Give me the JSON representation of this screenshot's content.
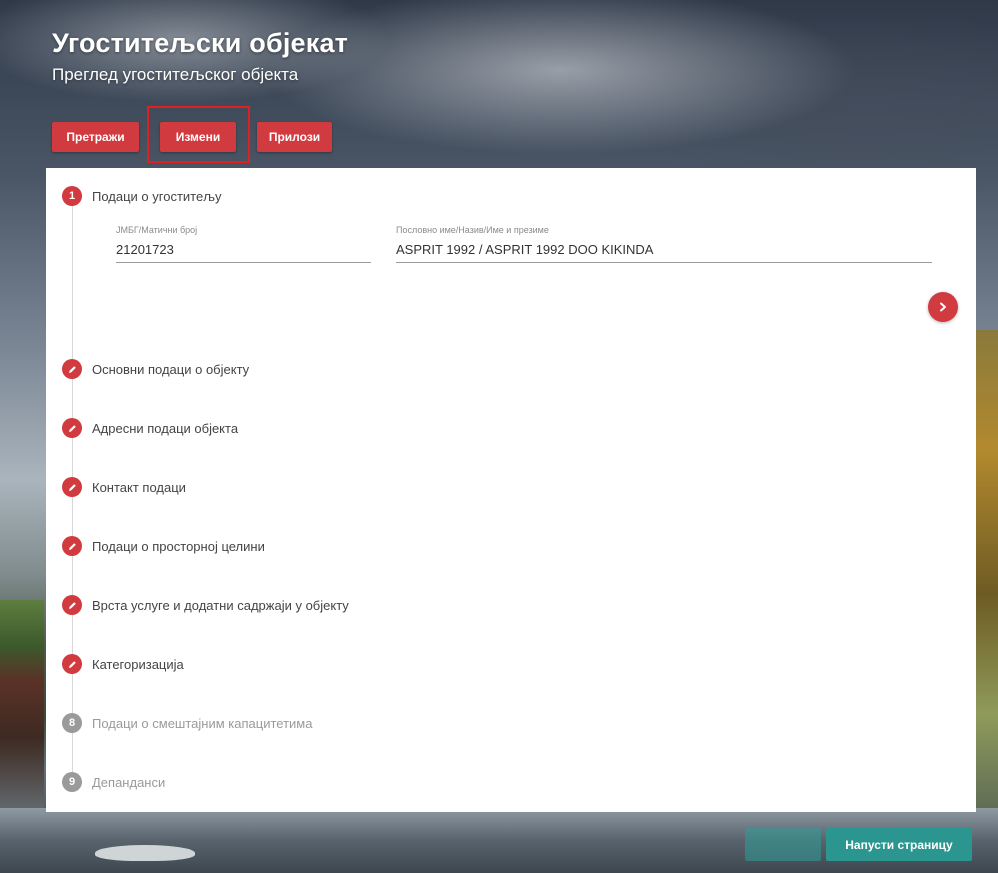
{
  "header": {
    "title": "Угоститељски објекат",
    "subtitle": "Преглед угоститељског објекта"
  },
  "toolbar": {
    "search_label": "Претражи",
    "edit_label": "Измени",
    "attachments_label": "Прилози"
  },
  "steps": [
    {
      "marker": "1",
      "label": "Подаци о угоститељу",
      "state": "active"
    },
    {
      "marker": "edit-icon",
      "label": "Основни подаци о објекту",
      "state": "editable"
    },
    {
      "marker": "edit-icon",
      "label": "Адресни подаци објекта",
      "state": "editable"
    },
    {
      "marker": "edit-icon",
      "label": "Контакт подаци",
      "state": "editable"
    },
    {
      "marker": "edit-icon",
      "label": "Подаци о просторној целини",
      "state": "editable"
    },
    {
      "marker": "edit-icon",
      "label": "Врста услуге и додатни садржаји у објекту",
      "state": "editable"
    },
    {
      "marker": "edit-icon",
      "label": "Категоризација",
      "state": "editable"
    },
    {
      "marker": "8",
      "label": "Подаци о смештајним капацитетима",
      "state": "disabled"
    },
    {
      "marker": "9",
      "label": "Депанданси",
      "state": "disabled"
    }
  ],
  "form": {
    "jmbg_label": "ЈМБГ/Матични број",
    "jmbg_value": "21201723",
    "name_label": "Пословно име/Назив/Име и презиме",
    "name_value": "ASPRIT 1992 / ASPRIT 1992 DOO KIKINDA"
  },
  "footer": {
    "blank_label": "",
    "leave_label": "Напусти страницу"
  },
  "colors": {
    "primary_red": "#d13a3f",
    "teal": "#2a968f",
    "disabled_grey": "#9a9a9a"
  }
}
